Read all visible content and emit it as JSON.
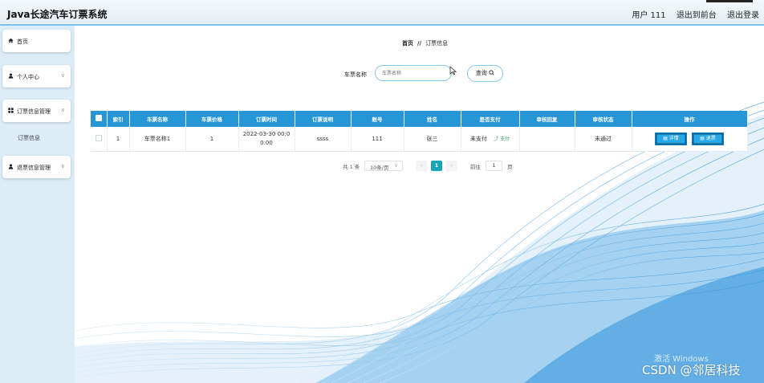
{
  "header": {
    "title": "Java长途汽车订票系统",
    "user": "用户 111",
    "back_to_front": "退出到前台",
    "logout": "退出登录"
  },
  "sidebar": {
    "items": [
      {
        "label": "首页",
        "icon": "home-icon"
      },
      {
        "label": "个人中心",
        "icon": "user-icon"
      },
      {
        "label": "订票信息管理",
        "icon": "grid-icon"
      },
      {
        "label": "退票信息管理",
        "icon": "user-icon"
      }
    ],
    "sub_item": "订票信息"
  },
  "breadcrumb": {
    "home": "首页",
    "separator": "//",
    "current": "订票信息"
  },
  "search": {
    "label": "车票名称",
    "placeholder": "车票名称",
    "button": "查询"
  },
  "table": {
    "columns": [
      "索引",
      "车票名称",
      "车票价格",
      "订票时间",
      "订票说明",
      "账号",
      "姓名",
      "是否支付",
      "审核回复",
      "审核状态",
      "操作"
    ],
    "rows": [
      {
        "index": "1",
        "ticket_name": "车票名称1",
        "price": "1",
        "time_line1": "2022-03-30 00:0",
        "time_line2": "0:00",
        "note": "ssss",
        "account": "111",
        "name": "张三",
        "paid": "未支付",
        "pay_action": "支付",
        "reply": "",
        "status": "未通过",
        "detail_btn": "详情",
        "refund_btn": "退票"
      }
    ]
  },
  "pagination": {
    "total": "共 1 条",
    "page_size": "10条/页",
    "current": "1",
    "goto_label": "前往",
    "goto_value": "1",
    "goto_unit": "页"
  },
  "watermark": {
    "windows": "激活 Windows",
    "csdn": "CSDN @邻居科技"
  },
  "colors": {
    "accent": "#2796d6",
    "header_border": "#7fc3ea",
    "sidebar_bg": "#dcedf7",
    "page_active": "#19a5b6",
    "pay_link": "#3aa66a"
  }
}
